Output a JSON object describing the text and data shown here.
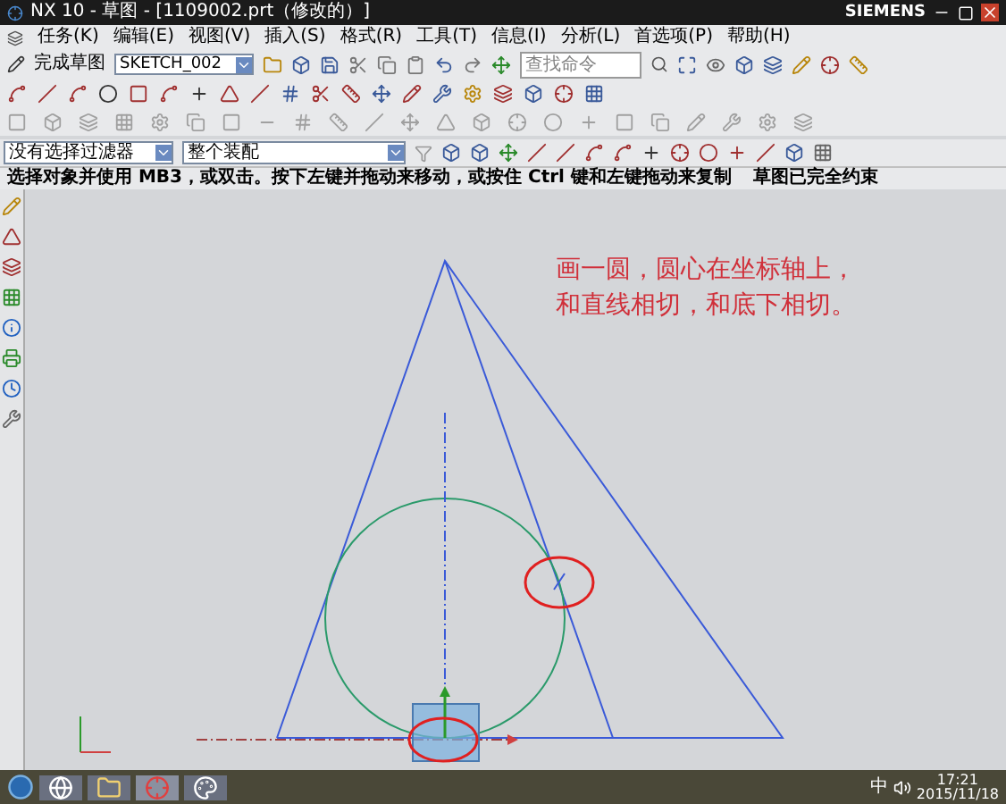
{
  "window": {
    "title": "NX 10 - 草图 - [1109002.prt（修改的）]",
    "brand": "SIEMENS"
  },
  "menu": [
    "任务(K)",
    "编辑(E)",
    "视图(V)",
    "插入(S)",
    "格式(R)",
    "工具(T)",
    "信息(I)",
    "分析(L)",
    "首选项(P)",
    "帮助(H)"
  ],
  "sketch_toolbar": {
    "finish_label": "完成草图",
    "sketch_name": "SKETCH_002",
    "search": {
      "placeholder": "查找命令"
    }
  },
  "selection_bar": {
    "filter": "没有选择过滤器",
    "scope": "整个装配"
  },
  "status_bar": {
    "prompt": "选择对象并使用 MB3，或双击。按下左键并拖动来移动，或按住 Ctrl 键和左键拖动来复制",
    "message": "草图已完全约束"
  },
  "annotation": [
    "画一圆，圆心在坐标轴上，",
    "和直线相切，和底下相切。"
  ],
  "taskbar": {
    "ime": "中",
    "time": "17:21",
    "date": "2015/11/18"
  }
}
